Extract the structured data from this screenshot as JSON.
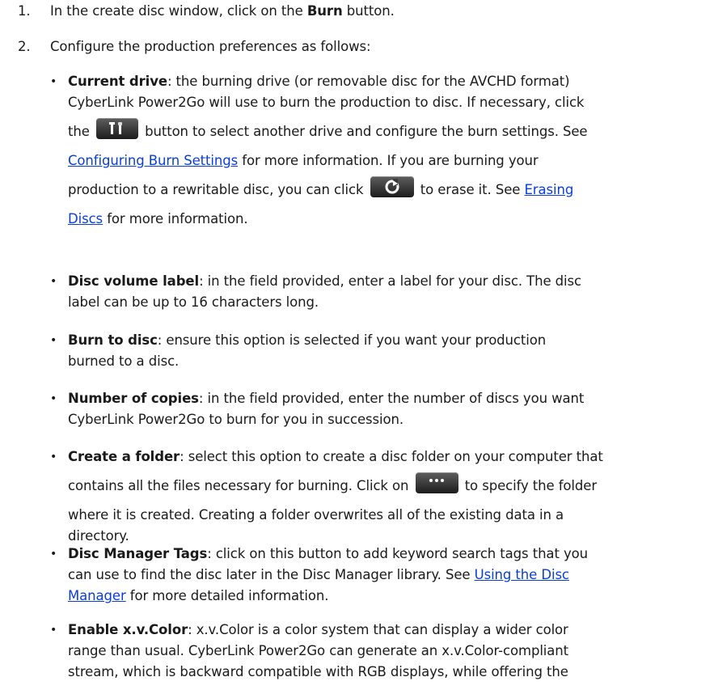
{
  "steps": [
    {
      "num": "1.",
      "pre": "In the create disc window, click on the ",
      "bold": "Burn",
      "post": " button."
    },
    {
      "num": "2.",
      "text": "Configure the production preferences as follows:"
    }
  ],
  "bullets": {
    "current_drive": {
      "term": "Current drive",
      "l1": ": the burning drive (or removable disc for the AVCHD format)",
      "l2": "CyberLink Power2Go will use to burn the production to disc. If necessary, click",
      "l3a": "the",
      "l3b": "button to select another drive and configure the burn settings. See",
      "link1": "Configuring Burn Settings",
      "l4": " for more information. If you are burning your",
      "l5a": "production to a rewritable disc, you can click",
      "l5b": "to erase it. See",
      "link2a": "Erasing",
      "link2b": "Discs",
      "l6": " for more information."
    },
    "volume_label": {
      "term": "Disc volume label",
      "l1": ": in the field provided, enter a label for your disc. The disc",
      "l2": "label can be up to 16 characters long."
    },
    "burn_to_disc": {
      "term": "Burn to disc",
      "l1": ": ensure this option is selected if you want your production",
      "l2": "burned to a disc."
    },
    "copies": {
      "term": "Number of copies",
      "l1": ": in the field provided, enter the number of discs you want",
      "l2": "CyberLink Power2Go to burn for you in succession."
    },
    "folder": {
      "term": "Create a folder",
      "l1": ": select this option to create a disc folder on your computer that",
      "l2a": "contains all the files necessary for burning. Click on",
      "l2b": "to specify the folder",
      "l3": "where it is created. Creating a folder overwrites all of the existing data in a",
      "l4": "directory."
    },
    "tags": {
      "term": "Disc Manager Tags",
      "l1": ": click on this button to add keyword search tags that you",
      "l2a": "can use to find the disc later in the Disc Manager library. See ",
      "link_a": "Using the Disc",
      "link_b": "Manager",
      "l3": " for more detailed information."
    },
    "xvcolor": {
      "term": "Enable x.v.Color",
      "l1": ": x.v.Color is a color system that can display a wider color",
      "l2": "range than usual. CyberLink Power2Go can generate an x.v.Color-compliant",
      "l3": "stream, which is backward compatible with RGB displays, while offering the"
    }
  },
  "bullet_glyph": "•",
  "icons": [
    "tools-icon",
    "erase-icon",
    "more-icon"
  ],
  "colors": {
    "link": "#0a3fd6",
    "text": "#1a1a1a",
    "button": "#2e2e2e"
  }
}
